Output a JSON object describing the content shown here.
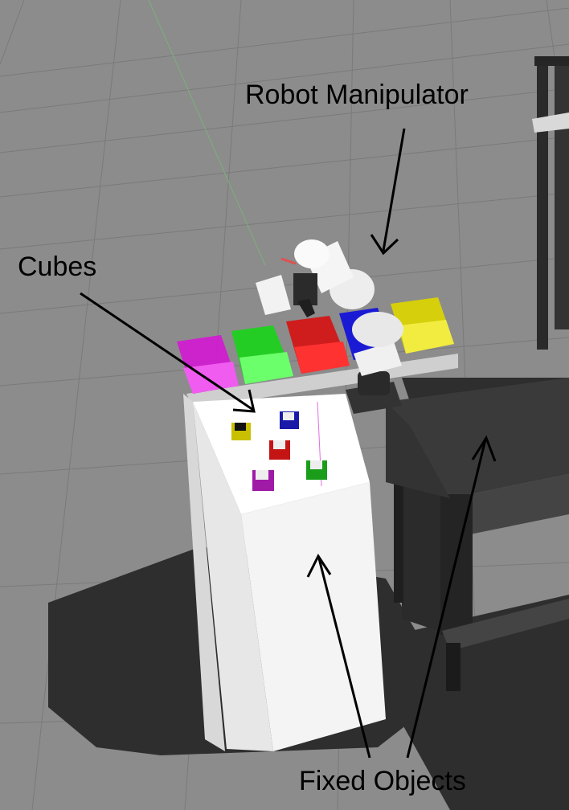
{
  "labels": {
    "robot": "Robot Manipulator",
    "cubes": "Cubes",
    "fixed": "Fixed Objects"
  },
  "scene": {
    "description_icon": "simulation-scene",
    "bins": [
      {
        "name": "magenta",
        "color": "#d21ad2"
      },
      {
        "name": "green",
        "color": "#1bd21b"
      },
      {
        "name": "red",
        "color": "#d51414"
      },
      {
        "name": "blue",
        "color": "#1a1ad5"
      },
      {
        "name": "yellow",
        "color": "#d6cf0b"
      }
    ],
    "cubes": [
      {
        "name": "yellow",
        "color": "#c8c000"
      },
      {
        "name": "blue",
        "color": "#1a1aa8"
      },
      {
        "name": "red",
        "color": "#c41414"
      },
      {
        "name": "green",
        "color": "#1a9e1a"
      },
      {
        "name": "purple",
        "color": "#a01aa8"
      }
    ]
  }
}
